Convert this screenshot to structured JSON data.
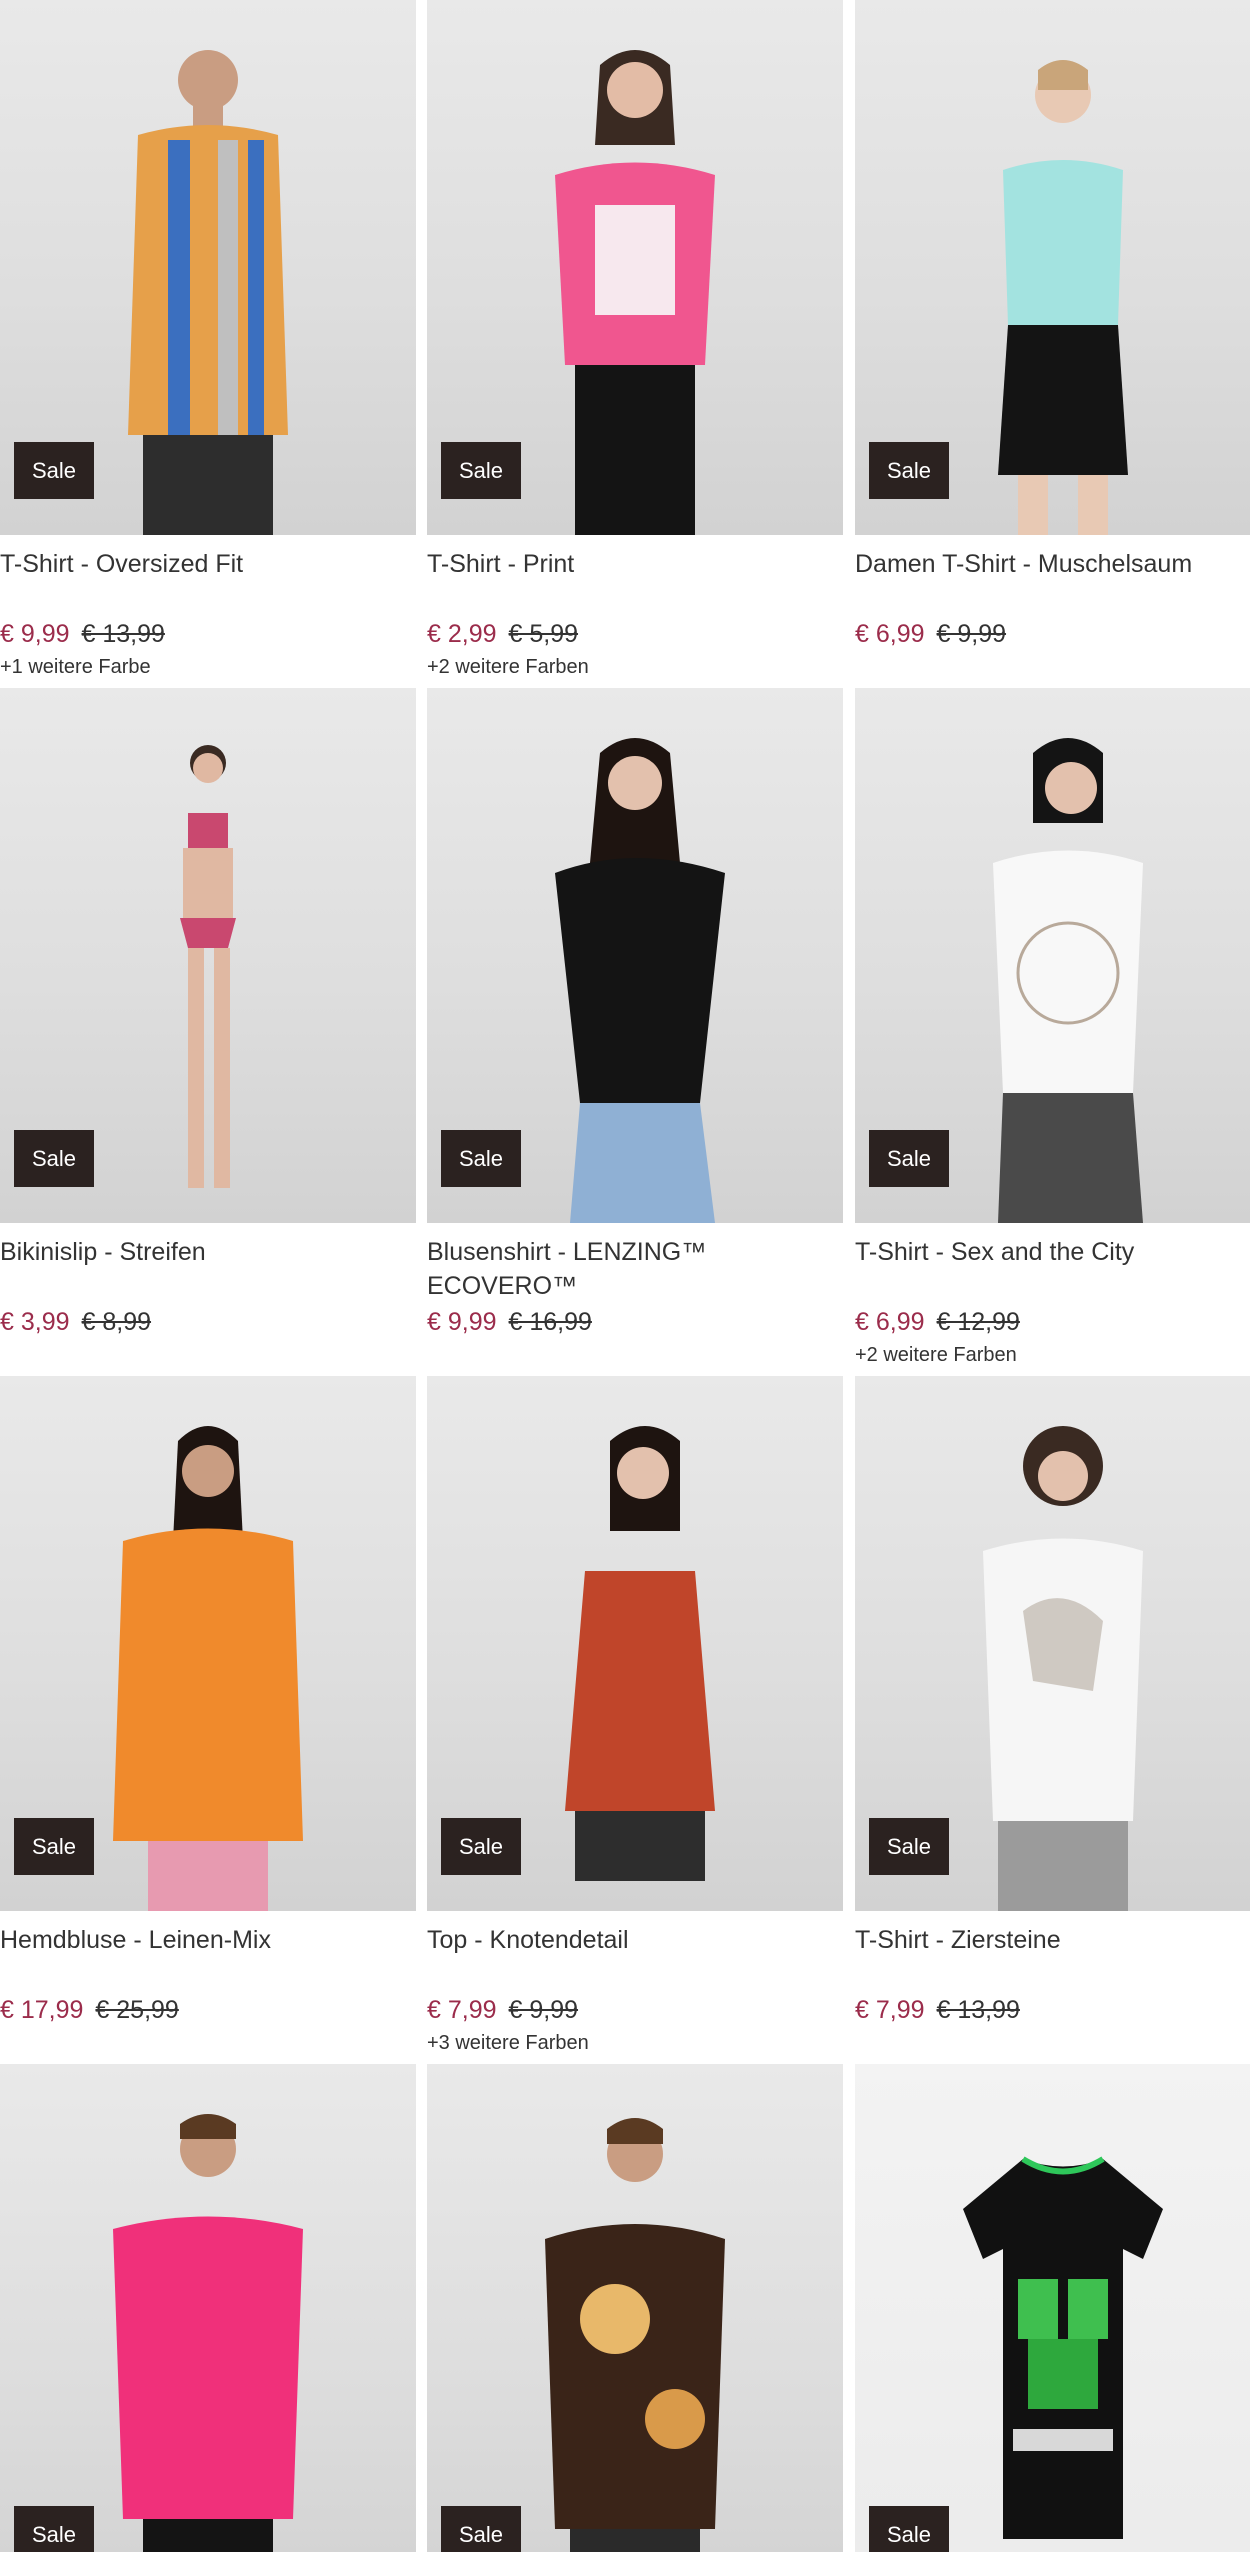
{
  "badge_label": "Sale",
  "colors": {
    "sale_badge": "#2b2220",
    "price_now": "#9b2c4b",
    "text": "#333333"
  },
  "products": [
    {
      "title": "T-Shirt - Oversized Fit",
      "price": "€ 9,99",
      "old_price": "€ 13,99",
      "more_colors": "+1 weitere Farbe",
      "garment_color": "#e6a04a"
    },
    {
      "title": "T-Shirt - Print",
      "price": "€ 2,99",
      "old_price": "€ 5,99",
      "more_colors": "+2 weitere Farben",
      "garment_color": "#f0568f"
    },
    {
      "title": "Damen T-Shirt - Muschelsaum",
      "price": "€ 6,99",
      "old_price": "€ 9,99",
      "more_colors": "",
      "garment_color": "#a3e3e0"
    },
    {
      "title": "Bikinislip - Streifen",
      "price": "€ 3,99",
      "old_price": "€ 8,99",
      "more_colors": "",
      "garment_color": "#c9486f"
    },
    {
      "title": "Blusenshirt - LENZING™ ECOVERO™",
      "price": "€ 9,99",
      "old_price": "€ 16,99",
      "more_colors": "",
      "garment_color": "#141414"
    },
    {
      "title": "T-Shirt - Sex and the City",
      "price": "€ 6,99",
      "old_price": "€ 12,99",
      "more_colors": "+2 weitere Farben",
      "garment_color": "#f8f8f8"
    },
    {
      "title": "Hemdbluse - Leinen-Mix",
      "price": "€ 17,99",
      "old_price": "€ 25,99",
      "more_colors": "",
      "garment_color": "#f08a2c"
    },
    {
      "title": "Top - Knotendetail",
      "price": "€ 7,99",
      "old_price": "€ 9,99",
      "more_colors": "+3 weitere Farben",
      "garment_color": "#c0452a"
    },
    {
      "title": "T-Shirt - Ziersteine",
      "price": "€ 7,99",
      "old_price": "€ 13,99",
      "more_colors": "",
      "garment_color": "#f6f6f6"
    },
    {
      "title": "",
      "price": "",
      "old_price": "",
      "more_colors": "",
      "garment_color": "#f0307a"
    },
    {
      "title": "",
      "price": "",
      "old_price": "",
      "more_colors": "",
      "garment_color": "#3a2418"
    },
    {
      "title": "",
      "price": "",
      "old_price": "",
      "more_colors": "",
      "garment_color": "#111111"
    }
  ]
}
